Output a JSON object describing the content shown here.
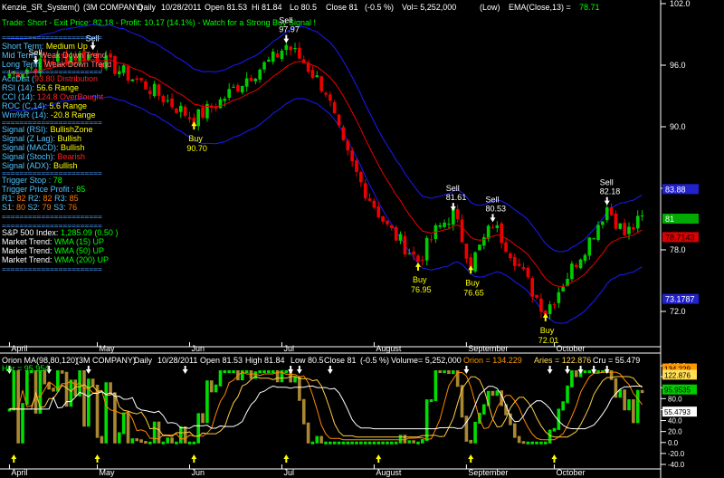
{
  "header": {
    "symbol": "Kenzie_SR_System()",
    "company": "(3M COMPANY)",
    "period": "Daily",
    "date": "10/28/2011",
    "open": "Open 81.53",
    "high": "Hi 81.84",
    "low": "Lo 80.5",
    "close": "Close 81",
    "change": "(-0.5 %)",
    "volume": "Vol= 5,252,000",
    "volume_note": "(Low)",
    "ema": "EMA(Close,13) =",
    "ema_value": "78.71"
  },
  "trade_line": "Trade: Short - Exit Price: 82.18 - Profit: 10.17 (14.1%) - Watch for a Strong Buy Signal !",
  "info_panel": [
    {
      "label": "Short Term: ",
      "value": "Medium Up",
      "value_color": "#ffff00"
    },
    {
      "label": "Mid Term: ",
      "value": "Weak Down Trend",
      "value_color": "#ff8080"
    },
    {
      "label": "Long Term: ",
      "value": "Weak Down Trend",
      "value_color": "#ff8080"
    },
    {
      "label": "AccDist (",
      "value": "93.80 Distribution",
      "value_color": "#ff2020"
    },
    {
      "label": "RSI (14): ",
      "value": "56.6 Range",
      "value_color": "#ffff00"
    },
    {
      "label": "CCI (14): ",
      "value": "124.8 OverBought",
      "value_color": "#ff2020"
    },
    {
      "label": "ROC (C,14): ",
      "value": "5.6 Range",
      "value_color": "#ffff00"
    },
    {
      "label": "Wm%R (14): ",
      "value": "-20.8 Range",
      "value_color": "#ffff00"
    },
    {
      "label": "Signal (RSI): ",
      "value": "BullishZone",
      "value_color": "#ffff00"
    },
    {
      "label": "Signal (Z Lag): ",
      "value": "Bullish",
      "value_color": "#ffff00"
    },
    {
      "label": "Signal (MACD): ",
      "value": "Bullish",
      "value_color": "#ffff00"
    },
    {
      "label": "Signal (Stoch): ",
      "value": "Bearish",
      "value_color": "#ff2020"
    },
    {
      "label": "Signal (ADX): ",
      "value": "Bullish",
      "value_color": "#ffff00"
    },
    {
      "label": "Trigger Stop : ",
      "value": "78",
      "value_color": "#00ff00"
    },
    {
      "label": "Trigger Price Profit : ",
      "value": "85",
      "value_color": "#00ff00"
    }
  ],
  "pivots_r": [
    "R1: ",
    "82",
    " R2: ",
    "82",
    " R3: ",
    "85"
  ],
  "pivots_s": [
    "S1: ",
    "80",
    " S2: ",
    "79",
    " S3: ",
    "76"
  ],
  "market_panel": [
    {
      "label": "S&P 500 Index: ",
      "value": "1,285.09 (0.50 )",
      "value_color": "#00ff00"
    },
    {
      "label": "Market Trend: ",
      "value": "WMA (15) UP",
      "value_color": "#00ff00"
    },
    {
      "label": "Market Trend: ",
      "value": "WMA (50) UP",
      "value_color": "#00ff00"
    },
    {
      "label": "Market Trend: ",
      "value": "WMA (200) UP",
      "value_color": "#00ff00"
    }
  ],
  "separator": "=======================",
  "lower_header": {
    "title": "Orion MA(98,80,120)",
    "company": "(3M COMPANY)",
    "period": "Daily",
    "date": "10/28/2011",
    "open": "Open 81.53",
    "high": "High 81.84",
    "low": "Low 80.5",
    "close": "Close 81",
    "change": "(-0.5 %)",
    "volume": "Volume= 5,252,000",
    "orion": "Orion = 134.229",
    "aries": "Aries = 122.876",
    "cru": "Cru = 55.479",
    "hor": "Hor = 95.954"
  },
  "chart_data": [
    {
      "type": "candlestick",
      "ylim": [
        69,
        102
      ],
      "y_ticks": [
        "102.0",
        "96.0",
        "90.0",
        "84.0",
        "78.0",
        "72.0"
      ],
      "y_tick_values": [
        102,
        96,
        90,
        84,
        78,
        72
      ],
      "price_badges": [
        {
          "label": "83.88",
          "value": 83.88,
          "color": "#2222cc",
          "text": "#ffffff"
        },
        {
          "label": "81",
          "value": 81,
          "color": "#00aa00",
          "text": "#ffffff"
        },
        {
          "label": "78.7143",
          "value": 79.2,
          "color": "#dd0000",
          "text": "#000000"
        },
        {
          "label": "73.1787",
          "value": 73.18,
          "color": "#2222cc",
          "text": "#ffffff"
        }
      ],
      "x_months": [
        {
          "label": "April",
          "index": 0
        },
        {
          "label": "May",
          "index": 20
        },
        {
          "label": "Jun",
          "index": 41
        },
        {
          "label": "Jul",
          "index": 62
        },
        {
          "label": "August",
          "index": 83
        },
        {
          "label": "September",
          "index": 104
        },
        {
          "label": "October",
          "index": 124
        }
      ],
      "bars_total": 145,
      "signals": [
        {
          "kind": "Sell",
          "price": "",
          "index": 19,
          "level": 97.3
        },
        {
          "kind": "Sell.",
          "price": "",
          "index": 6,
          "level": 95.9
        },
        {
          "kind": "Buy",
          "price": "90.70",
          "index": 42,
          "level": 90.7
        },
        {
          "kind": "Sell",
          "price": "97.97",
          "index": 63,
          "level": 97.97
        },
        {
          "kind": "Buy",
          "price": "76.95",
          "index": 93,
          "level": 76.95
        },
        {
          "kind": "Sell",
          "price": "81.61",
          "index": 101,
          "level": 81.61
        },
        {
          "kind": "Buy",
          "price": "76.65",
          "index": 105,
          "level": 76.65
        },
        {
          "kind": "Sell",
          "price": "80.53",
          "index": 110,
          "level": 80.53
        },
        {
          "kind": "Buy",
          "price": "72.01",
          "index": 122,
          "level": 72.01
        },
        {
          "kind": "Sell",
          "price": "82.18",
          "index": 136,
          "level": 82.18
        }
      ],
      "colors": {
        "up": "#00cc00",
        "down": "#ee0000",
        "ema": "#ee0000",
        "bands": "#1a1aff",
        "text_signal": "#ffff00",
        "text_sell": "#ffffff"
      }
    },
    {
      "type": "line",
      "ylim": [
        38,
        146
      ],
      "y_ticks": [
        "140.0",
        "120.0",
        "100.0",
        "80.0",
        "60.0",
        "40.0",
        "20.0",
        "0.0",
        "-20.0",
        "-40.0"
      ],
      "y_tick_values": [
        140,
        120,
        100,
        80,
        60,
        40,
        20,
        0,
        -20,
        -40
      ],
      "value_badges": [
        {
          "label": "134.229",
          "value": 134.2,
          "color": "#ff9900",
          "text": "#000000"
        },
        {
          "label": "122.876",
          "value": 122.9,
          "color": "#ffdd55",
          "text": "#000000"
        },
        {
          "label": "95.9535",
          "value": 95.9,
          "color": "#00cc00",
          "text": "#000000"
        },
        {
          "label": "55.4793",
          "value": 55.5,
          "color": "#ffffff",
          "text": "#000000"
        }
      ],
      "series_colors": [
        "#00dd00",
        "#ff8800",
        "#ffcc44",
        "#ffffff"
      ]
    }
  ]
}
